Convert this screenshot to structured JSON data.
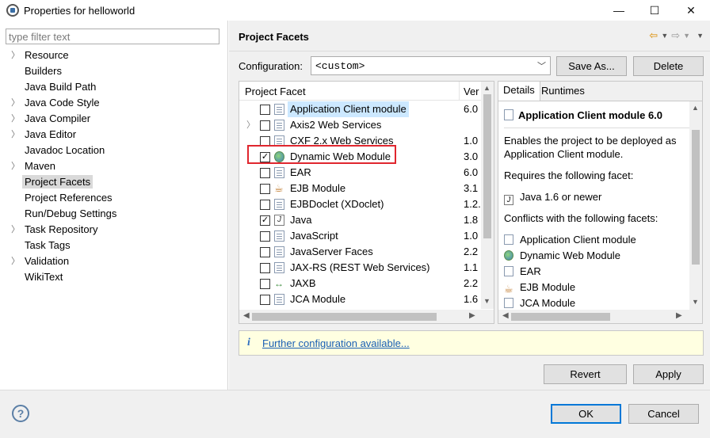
{
  "window": {
    "title": "Properties for helloworld",
    "minimize": "—",
    "maximize": "☐",
    "close": "✕"
  },
  "filter": {
    "placeholder": "type filter text"
  },
  "nav": {
    "items": [
      {
        "label": "Resource",
        "expandable": true
      },
      {
        "label": "Builders",
        "expandable": false
      },
      {
        "label": "Java Build Path",
        "expandable": false
      },
      {
        "label": "Java Code Style",
        "expandable": true
      },
      {
        "label": "Java Compiler",
        "expandable": true
      },
      {
        "label": "Java Editor",
        "expandable": true
      },
      {
        "label": "Javadoc Location",
        "expandable": false
      },
      {
        "label": "Maven",
        "expandable": true
      },
      {
        "label": "Project Facets",
        "expandable": false,
        "selected": true
      },
      {
        "label": "Project References",
        "expandable": false
      },
      {
        "label": "Run/Debug Settings",
        "expandable": false
      },
      {
        "label": "Task Repository",
        "expandable": true
      },
      {
        "label": "Task Tags",
        "expandable": false
      },
      {
        "label": "Validation",
        "expandable": true
      },
      {
        "label": "WikiText",
        "expandable": false
      }
    ]
  },
  "page": {
    "title": "Project Facets",
    "configuration_label": "Configuration:",
    "configuration_value": "<custom>",
    "save_as": "Save As...",
    "delete": "Delete"
  },
  "facets": {
    "col_facet": "Project Facet",
    "col_version": "Ver",
    "rows": [
      {
        "name": "Application Client module",
        "version": "6.0",
        "checked": false,
        "icon": "page-icon",
        "selected": true
      },
      {
        "name": "Axis2 Web Services",
        "version": "",
        "checked": false,
        "icon": "page-icon",
        "expandable": true
      },
      {
        "name": "CXF 2.x Web Services",
        "version": "1.0",
        "checked": false,
        "icon": "page-icon"
      },
      {
        "name": "Dynamic Web Module",
        "version": "3.0",
        "checked": true,
        "icon": "globe-icon"
      },
      {
        "name": "EAR",
        "version": "6.0",
        "checked": false,
        "icon": "page-icon"
      },
      {
        "name": "EJB Module",
        "version": "3.1",
        "checked": false,
        "icon": "bean-icon"
      },
      {
        "name": "EJBDoclet (XDoclet)",
        "version": "1.2.",
        "checked": false,
        "icon": "page-icon"
      },
      {
        "name": "Java",
        "version": "1.8",
        "checked": true,
        "icon": "jar-icon"
      },
      {
        "name": "JavaScript",
        "version": "1.0",
        "checked": false,
        "icon": "page-icon"
      },
      {
        "name": "JavaServer Faces",
        "version": "2.2",
        "checked": false,
        "icon": "page-icon"
      },
      {
        "name": "JAX-RS (REST Web Services)",
        "version": "1.1",
        "checked": false,
        "icon": "page-icon"
      },
      {
        "name": "JAXB",
        "version": "2.2",
        "checked": false,
        "icon": "xml-icon"
      },
      {
        "name": "JCA Module",
        "version": "1.6",
        "checked": false,
        "icon": "page-icon"
      }
    ]
  },
  "details": {
    "tab_details": "Details",
    "tab_runtimes": "Runtimes",
    "title": "Application Client module 6.0",
    "description_1": "Enables the project to be deployed as",
    "description_2": "Application Client module.",
    "requires_label": "Requires the following facet:",
    "requires_item": "Java 1.6 or newer",
    "conflicts_label": "Conflicts with the following facets:",
    "conflicts": [
      {
        "name": "Application Client module",
        "icon": "page-icon"
      },
      {
        "name": "Dynamic Web Module",
        "icon": "globe-icon"
      },
      {
        "name": "EAR",
        "icon": "page-icon"
      },
      {
        "name": "EJB Module",
        "icon": "bean-icon"
      },
      {
        "name": "JCA Module",
        "icon": "page-icon"
      }
    ]
  },
  "info": {
    "icon": "i",
    "link": "Further configuration available..."
  },
  "buttons": {
    "revert": "Revert",
    "apply": "Apply",
    "ok": "OK",
    "cancel": "Cancel",
    "help": "?"
  },
  "colors": {
    "highlight_box": "#e0262e",
    "selection": "#cce8ff",
    "link": "#1a5fb4"
  }
}
